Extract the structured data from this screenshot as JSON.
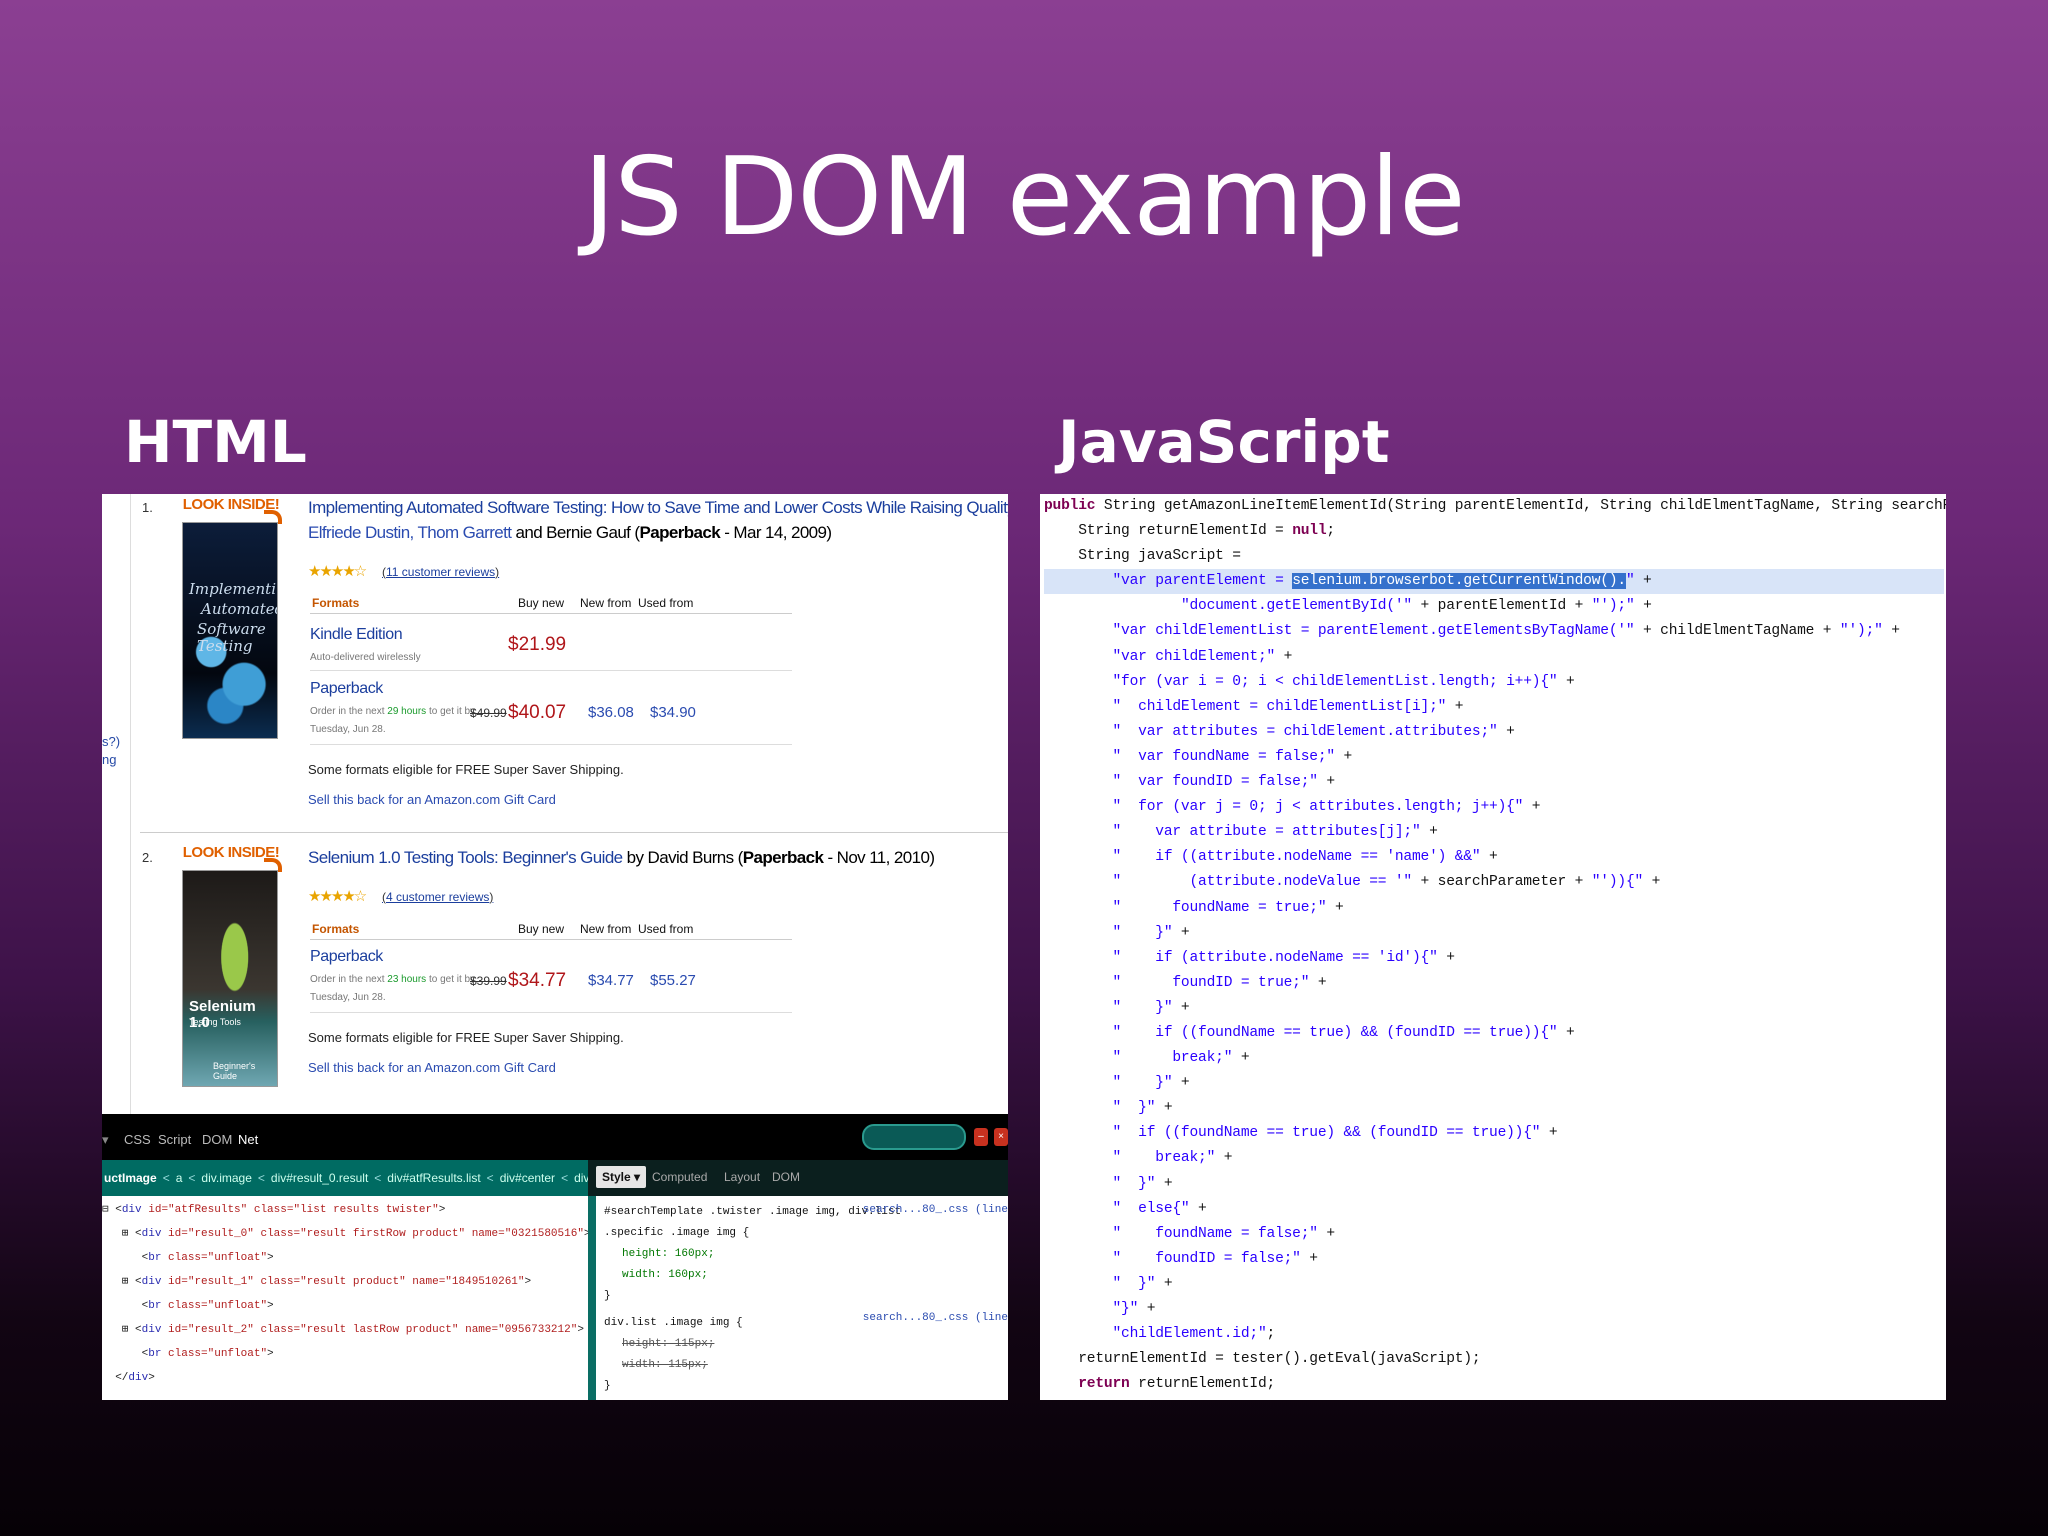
{
  "slide": {
    "title": "JS DOM example",
    "left_heading": "HTML",
    "right_heading": "JavaScript"
  },
  "left_panel": {
    "edge_fragments": [
      "s?)",
      "ng"
    ],
    "results": [
      {
        "number": "1.",
        "look_inside": "LOOK INSIDE!",
        "cover_lines": [
          "Implementing",
          "Automated",
          "Software Testing"
        ],
        "title": "Implementing Automated Software Testing: How to Save Time and Lower Costs While Raising Quality",
        "by": "by",
        "authors": "Elfriede Dustin, Thom Garrett",
        "and_author": "and Bernie Gauf",
        "format_bold": "Paperback",
        "date": "- Mar 14, 2009)",
        "stars": "★★★★☆",
        "reviews": "11 customer reviews",
        "col_formats": "Formats",
        "col_buy_new": "Buy new",
        "col_new_from": "New from",
        "col_used_from": "Used from",
        "formats": [
          {
            "name": "Kindle Edition",
            "sub": "Auto-delivered wirelessly",
            "buy_new": "$21.99"
          },
          {
            "name": "Paperback",
            "sub_pre": "Order in the next",
            "hours": "29 hours",
            "sub_post": "to get it by",
            "sub2": "Tuesday, Jun 28.",
            "list_price": "$49.99",
            "buy_new": "$40.07",
            "new_from": "$36.08",
            "used_from": "$34.90"
          }
        ],
        "shipping": "Some formats eligible for FREE Super Saver Shipping.",
        "gift": "Sell this back for an Amazon.com Gift Card"
      },
      {
        "number": "2.",
        "look_inside": "LOOK INSIDE!",
        "cover_lines": [
          "Selenium 1.0",
          "Testing Tools",
          "Beginner's Guide"
        ],
        "title": "Selenium 1.0 Testing Tools: Beginner's Guide",
        "by": "by David Burns",
        "format_bold": "Paperback",
        "date": "- Nov 11, 2010)",
        "stars": "★★★★☆",
        "reviews": "4 customer reviews",
        "col_formats": "Formats",
        "col_buy_new": "Buy new",
        "col_new_from": "New from",
        "col_used_from": "Used from",
        "formats": [
          {
            "name": "Paperback",
            "sub_pre": "Order in the next",
            "hours": "23 hours",
            "sub_post": "to get it by",
            "sub2": "Tuesday, Jun 28.",
            "list_price": "$39.99",
            "buy_new": "$34.77",
            "new_from": "$34.77",
            "used_from": "$55.27"
          }
        ],
        "shipping": "Some formats eligible for FREE Super Saver Shipping.",
        "gift": "Sell this back for an Amazon.com Gift Card"
      }
    ],
    "devtools": {
      "tabs": [
        "CSS",
        "Script",
        "DOM",
        "Net"
      ],
      "crumbs": [
        "uctImage",
        "a",
        "div.image",
        "div#result_0.result",
        "div#atfResults.list",
        "div#center",
        "div#rightResult"
      ],
      "side_tabs": [
        "Style ▾",
        "Computed",
        "Layout",
        "DOM"
      ],
      "html_lines": [
        {
          "pre": "⊟ <",
          "tag": "div",
          "attrs": " id=\"atfResults\" class=\"list results twister\"",
          "post": ">"
        },
        {
          "pre": "   ⊞ <",
          "tag": "div",
          "attrs": " id=\"result_0\" class=\"result firstRow product\" name=\"0321580516\"",
          "post": ">"
        },
        {
          "pre": "      <",
          "tag": "br",
          "attrs": " class=\"unfloat\"",
          "post": ">"
        },
        {
          "pre": "   ⊞ <",
          "tag": "div",
          "attrs": " id=\"result_1\" class=\"result product\" name=\"1849510261\"",
          "post": ">"
        },
        {
          "pre": "      <",
          "tag": "br",
          "attrs": " class=\"unfloat\"",
          "post": ">"
        },
        {
          "pre": "   ⊞ <",
          "tag": "div",
          "attrs": " id=\"result_2\" class=\"result lastRow product\" name=\"0956733212\"",
          "post": ">"
        },
        {
          "pre": "      <",
          "tag": "br",
          "attrs": " class=\"unfloat\"",
          "post": ">"
        },
        {
          "pre": "  </",
          "tag": "div",
          "attrs": "",
          "post": ">"
        }
      ],
      "css": {
        "rule1_sel1": "#searchTemplate .twister .image img, div.list",
        "rule1_sel2": ".specific .image img {",
        "rule1_src": "search...80_.css (line",
        "rule1_p1": "height: 160px;",
        "rule1_p2": "width: 160px;",
        "close": "}",
        "rule2_sel": "div.list .image img {",
        "rule2_src": "search...80_.css (line",
        "rule2_p1": "height: 115px;",
        "rule2_p2": "width: 115px;"
      }
    }
  },
  "right_panel": {
    "code_lines": [
      [
        {
          "t": "public",
          "c": "kw"
        },
        {
          "t": " String getAmazonLineItemElementId(String parentElementId, String childElmentTagName, String searchParameter){"
        }
      ],
      [
        {
          "t": "    String returnElementId = "
        },
        {
          "t": "null",
          "c": "kw"
        },
        {
          "t": ";"
        }
      ],
      [
        {
          "t": "    String javaScript ="
        }
      ],
      [
        {
          "t": "        "
        },
        {
          "t": "\"var parentElement = ",
          "c": "str"
        },
        {
          "t": "selenium.browserbot.getCurrentWindow().",
          "c": "sel"
        },
        {
          "t": "\"",
          "c": "str"
        },
        {
          "t": " +"
        }
      ],
      [
        {
          "t": "                "
        },
        {
          "t": "\"document.getElementById('\"",
          "c": "str"
        },
        {
          "t": " + parentElementId + "
        },
        {
          "t": "\"');\"",
          "c": "str"
        },
        {
          "t": " +"
        }
      ],
      [
        {
          "t": "        "
        },
        {
          "t": "\"var childElementList = parentElement.getElementsByTagName('\"",
          "c": "str"
        },
        {
          "t": " + childElmentTagName + "
        },
        {
          "t": "\"');\"",
          "c": "str"
        },
        {
          "t": " +"
        }
      ],
      [
        {
          "t": "        "
        },
        {
          "t": "\"var childElement;\"",
          "c": "str"
        },
        {
          "t": " +"
        }
      ],
      [
        {
          "t": "        "
        },
        {
          "t": "\"for (var i = 0; i < childElementList.length; i++){\"",
          "c": "str"
        },
        {
          "t": " +"
        }
      ],
      [
        {
          "t": "        "
        },
        {
          "t": "\"  childElement = childElementList[i];\"",
          "c": "str"
        },
        {
          "t": " +"
        }
      ],
      [
        {
          "t": "        "
        },
        {
          "t": "\"  var attributes = childElement.attributes;\"",
          "c": "str"
        },
        {
          "t": " +"
        }
      ],
      [
        {
          "t": "        "
        },
        {
          "t": "\"  var foundName = false;\"",
          "c": "str"
        },
        {
          "t": " +"
        }
      ],
      [
        {
          "t": "        "
        },
        {
          "t": "\"  var foundID = false;\"",
          "c": "str"
        },
        {
          "t": " +"
        }
      ],
      [
        {
          "t": "        "
        },
        {
          "t": "\"  for (var j = 0; j < attributes.length; j++){\"",
          "c": "str"
        },
        {
          "t": " +"
        }
      ],
      [
        {
          "t": "        "
        },
        {
          "t": "\"    var attribute = attributes[j];\"",
          "c": "str"
        },
        {
          "t": " +"
        }
      ],
      [
        {
          "t": "        "
        },
        {
          "t": "\"    if ((attribute.nodeName == 'name') &&\"",
          "c": "str"
        },
        {
          "t": " +"
        }
      ],
      [
        {
          "t": "        "
        },
        {
          "t": "\"        (attribute.nodeValue == '\"",
          "c": "str"
        },
        {
          "t": " + searchParameter + "
        },
        {
          "t": "\"')){\"",
          "c": "str"
        },
        {
          "t": " +"
        }
      ],
      [
        {
          "t": "        "
        },
        {
          "t": "\"      foundName = true;\"",
          "c": "str"
        },
        {
          "t": " +"
        }
      ],
      [
        {
          "t": "        "
        },
        {
          "t": "\"    }\"",
          "c": "str"
        },
        {
          "t": " +"
        }
      ],
      [
        {
          "t": "        "
        },
        {
          "t": "\"    if (attribute.nodeName == 'id'){\"",
          "c": "str"
        },
        {
          "t": " +"
        }
      ],
      [
        {
          "t": "        "
        },
        {
          "t": "\"      foundID = true;\"",
          "c": "str"
        },
        {
          "t": " +"
        }
      ],
      [
        {
          "t": "        "
        },
        {
          "t": "\"    }\"",
          "c": "str"
        },
        {
          "t": " +"
        }
      ],
      [
        {
          "t": "        "
        },
        {
          "t": "\"    if ((foundName == true) && (foundID == true)){\"",
          "c": "str"
        },
        {
          "t": " +"
        }
      ],
      [
        {
          "t": "        "
        },
        {
          "t": "\"      break;\"",
          "c": "str"
        },
        {
          "t": " +"
        }
      ],
      [
        {
          "t": "        "
        },
        {
          "t": "\"    }\"",
          "c": "str"
        },
        {
          "t": " +"
        }
      ],
      [
        {
          "t": "        "
        },
        {
          "t": "\"  }\"",
          "c": "str"
        },
        {
          "t": " +"
        }
      ],
      [
        {
          "t": "        "
        },
        {
          "t": "\"  if ((foundName == true) && (foundID == true)){\"",
          "c": "str"
        },
        {
          "t": " +"
        }
      ],
      [
        {
          "t": "        "
        },
        {
          "t": "\"    break;\"",
          "c": "str"
        },
        {
          "t": " +"
        }
      ],
      [
        {
          "t": "        "
        },
        {
          "t": "\"  }\"",
          "c": "str"
        },
        {
          "t": " +"
        }
      ],
      [
        {
          "t": "        "
        },
        {
          "t": "\"  else{\"",
          "c": "str"
        },
        {
          "t": " +"
        }
      ],
      [
        {
          "t": "        "
        },
        {
          "t": "\"    foundName = false;\"",
          "c": "str"
        },
        {
          "t": " +"
        }
      ],
      [
        {
          "t": "        "
        },
        {
          "t": "\"    foundID = false;\"",
          "c": "str"
        },
        {
          "t": " +"
        }
      ],
      [
        {
          "t": "        "
        },
        {
          "t": "\"  }\"",
          "c": "str"
        },
        {
          "t": " +"
        }
      ],
      [
        {
          "t": "        "
        },
        {
          "t": "\"}\"",
          "c": "str"
        },
        {
          "t": " +"
        }
      ],
      [
        {
          "t": "        "
        },
        {
          "t": "\"childElement.id;\"",
          "c": "str"
        },
        {
          "t": ";"
        }
      ],
      [
        {
          "t": "    returnElementId = tester().getEval(javaScript);"
        }
      ],
      [
        {
          "t": "    "
        },
        {
          "t": "return",
          "c": "kw"
        },
        {
          "t": " returnElementId;"
        }
      ]
    ]
  }
}
